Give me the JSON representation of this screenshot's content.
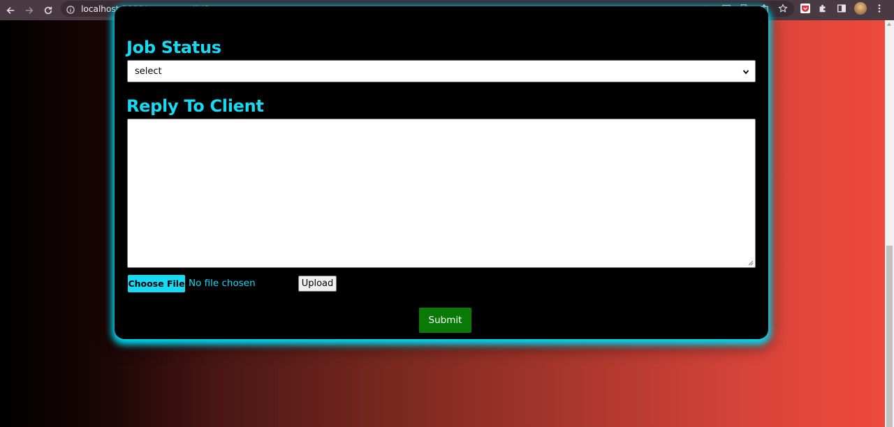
{
  "browser": {
    "url_host": "localhost",
    "url_path": ":3000/manageredit/6",
    "back_icon": "arrow-left-icon",
    "forward_icon": "arrow-right-icon",
    "reload_icon": "reload-icon"
  },
  "form": {
    "job_status_heading": "Job Status",
    "job_status_selected": "select",
    "reply_heading": "Reply To Client",
    "reply_value": "",
    "choose_file_label": "Choose File",
    "file_status": "No file chosen",
    "upload_label": "Upload",
    "submit_label": "Submit"
  },
  "colors": {
    "accent": "#18d9f2",
    "submit": "#0a7a06",
    "card": "#000000"
  }
}
